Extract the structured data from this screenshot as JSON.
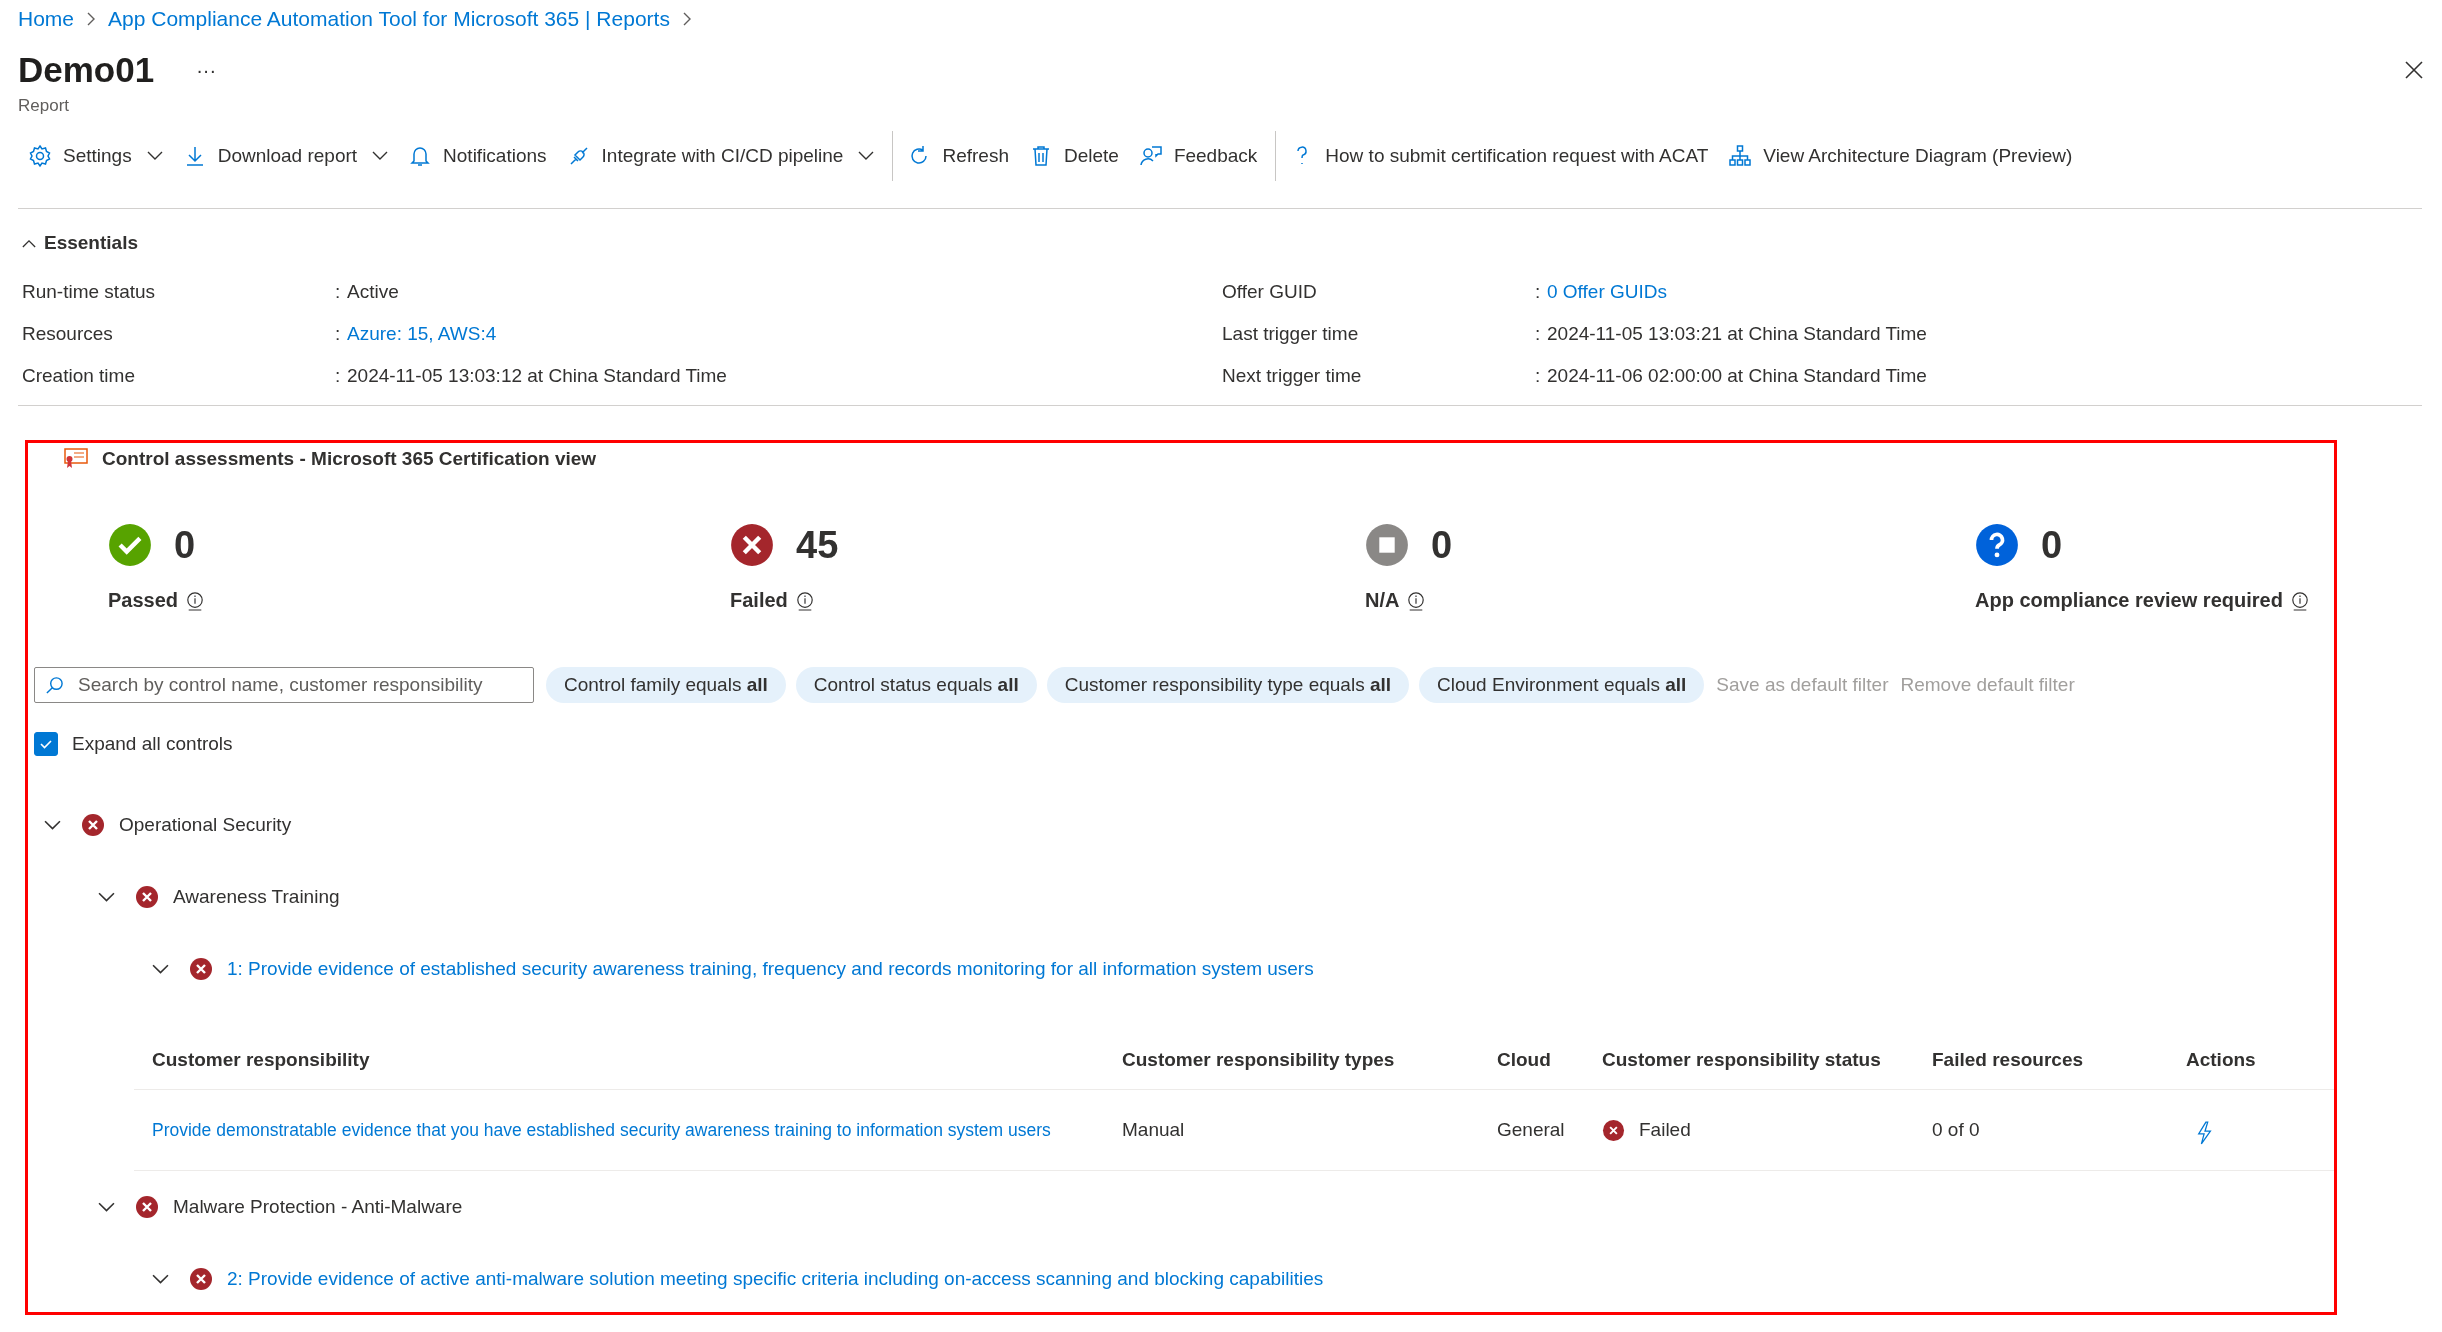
{
  "breadcrumb": [
    "Home",
    "App Compliance Automation Tool for Microsoft 365 | Reports"
  ],
  "title": "Demo01",
  "more": "···",
  "subtitle": "Report",
  "toolbar": [
    [
      {
        "kind": "settings",
        "label": "Settings",
        "has_menu": true
      },
      {
        "kind": "download",
        "label": "Download report",
        "has_menu": true
      },
      {
        "kind": "notifications",
        "label": "Notifications",
        "has_menu": false
      },
      {
        "kind": "integrate",
        "label": "Integrate with CI/CD pipeline",
        "has_menu": true
      }
    ],
    [
      {
        "kind": "refresh",
        "label": "Refresh",
        "has_menu": false
      },
      {
        "kind": "delete",
        "label": "Delete",
        "has_menu": false
      },
      {
        "kind": "feedback",
        "label": "Feedback",
        "has_menu": false
      }
    ],
    [
      {
        "kind": "help",
        "label": "How to submit certification request with ACAT",
        "has_menu": false
      },
      {
        "kind": "diagram",
        "label": "View Architecture Diagram (Preview)",
        "has_menu": false
      }
    ]
  ],
  "essentials": {
    "title": "Essentials",
    "expanded": true,
    "separator": ":",
    "columns": [
      [
        {
          "label": "Run-time status",
          "value": "Active",
          "link": false
        },
        {
          "label": "Resources",
          "value": "Azure: 15, AWS:4",
          "link": true
        },
        {
          "label": "Creation time",
          "value": "2024-11-05 13:03:12 at China Standard Time",
          "link": false
        }
      ],
      [
        {
          "label": "Offer GUID",
          "value": "0 Offer GUIDs",
          "link": true
        },
        {
          "label": "Last trigger time",
          "value": "2024-11-05 13:03:21 at China Standard Time",
          "link": false
        },
        {
          "label": "Next trigger time",
          "value": "2024-11-06 02:00:00 at China Standard Time",
          "link": false
        }
      ]
    ]
  },
  "assessment": {
    "title": "Control assessments - Microsoft 365 Certification view",
    "stats": [
      {
        "kind": "passed",
        "count": "0",
        "label": "Passed"
      },
      {
        "kind": "failed",
        "count": "45",
        "label": "Failed"
      },
      {
        "kind": "na",
        "count": "0",
        "label": "N/A"
      },
      {
        "kind": "review",
        "count": "0",
        "label": "App compliance review required"
      }
    ],
    "search": {
      "placeholder": "Search by control name, customer responsibility"
    },
    "filters": [
      "Control family equals **all**",
      "Control status equals **all**",
      "Customer responsibility type equals **all**",
      "Cloud Environment equals **all**"
    ],
    "filter_links": [
      {
        "label": "Save as default filter",
        "disabled": true
      },
      {
        "label": "Remove default filter",
        "disabled": true
      }
    ],
    "expand_all": {
      "label": "Expand all controls",
      "checked": true
    },
    "tree": [
      {
        "label": "Operational Security",
        "failed": true,
        "expanded": true,
        "link": false,
        "children": [
          {
            "label": "Awareness Training",
            "failed": true,
            "expanded": true,
            "link": false,
            "children": [
              {
                "label": "1: Provide evidence of established security awareness training, frequency and records monitoring for all information system users",
                "failed": true,
                "expanded": true,
                "link": true,
                "table": {
                  "columns": [
                    "Customer responsibility",
                    "Customer responsibility types",
                    "Cloud",
                    "Customer responsibility status",
                    "Failed resources",
                    "Actions"
                  ],
                  "rows": [
                    {
                      "responsibility": "Provide demonstratable evidence that you have established security awareness training to information system users",
                      "type": "Manual",
                      "cloud": "General",
                      "failed": true,
                      "status_text": "Failed",
                      "failed_resources": "0 of 0"
                    }
                  ]
                }
              }
            ]
          },
          {
            "label": "Malware Protection - Anti-Malware",
            "failed": true,
            "expanded": true,
            "link": false,
            "children": [
              {
                "label": "2: Provide evidence of active anti-malware solution meeting specific criteria including on-access scanning and blocking capabilities",
                "failed": true,
                "expanded": true,
                "link": true
              }
            ]
          }
        ]
      }
    ]
  }
}
